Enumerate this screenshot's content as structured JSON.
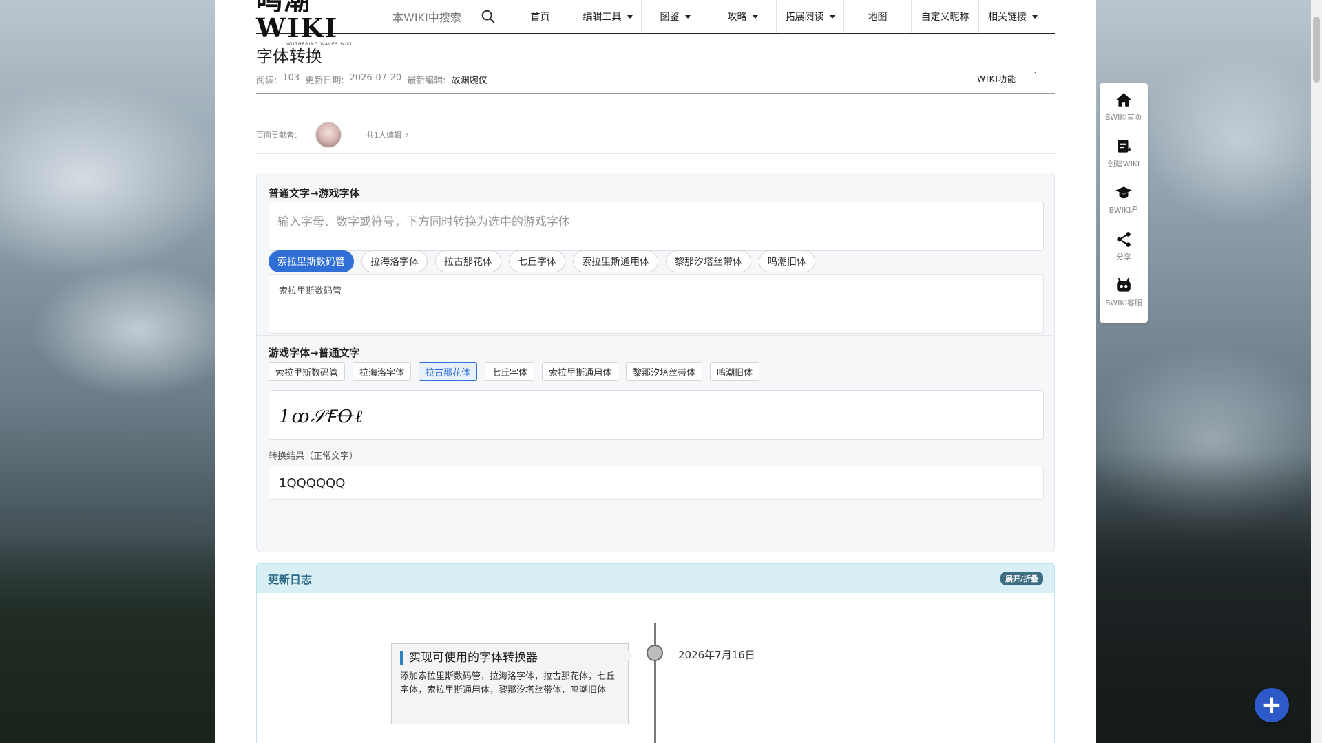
{
  "logo": {
    "main": "鸣潮WIKI",
    "sub": "WUTHERING WAVES WIKI"
  },
  "search": {
    "placeholder": "本WIKI中搜索"
  },
  "nav": [
    {
      "label": "首页",
      "dropdown": false
    },
    {
      "label": "编辑工具",
      "dropdown": true
    },
    {
      "label": "图鉴",
      "dropdown": true
    },
    {
      "label": "攻略",
      "dropdown": true
    },
    {
      "label": "拓展阅读",
      "dropdown": true
    },
    {
      "label": "地图",
      "dropdown": false
    },
    {
      "label": "自定义昵称",
      "dropdown": false
    },
    {
      "label": "相关链接",
      "dropdown": true
    }
  ],
  "page": {
    "title": "字体转换",
    "reads_label": "阅读:",
    "reads": "103",
    "updated_label": "更新日期:",
    "updated": "2026-07-20",
    "editor_label": "最新编辑:",
    "editor": "故渊婉仪",
    "wiki_func": "WIKI功能",
    "wiki_func_caret": "ˇ"
  },
  "contributors": {
    "label": "页面贡献者：",
    "count_text": "共1人编辑",
    "chevron": "›"
  },
  "converter": {
    "to_game_title": "普通文字→游戏字体",
    "input_placeholder": "输入字母、数字或符号，下方同时转换为选中的游戏字体",
    "fonts": [
      "索拉里斯数码管",
      "拉海洛字体",
      "拉古那花体",
      "七丘字体",
      "索拉里斯通用体",
      "黎那汐塔丝带体",
      "鸣潮旧体"
    ],
    "selected_font_top": "索拉里斯数码管",
    "output_text": "索拉里斯数码管",
    "to_text_title": "游戏字体→普通文字",
    "selected_font_bottom": "拉古那花体",
    "glyph_input": "1ꝏ𝒮ꞘꝊℓ",
    "result_label": "转换结果（正常文字）",
    "result_value": "1QQQQQQ"
  },
  "changelog": {
    "title": "更新日志",
    "toggle": "展开/折叠",
    "entries": [
      {
        "date": "2026年7月16日",
        "title": "实现可使用的字体转换器",
        "body": "添加索拉里斯数码管，拉海洛字体，拉古那花体，七丘字体，索拉里斯通用体，黎那汐塔丝带体，鸣潮旧体"
      }
    ]
  },
  "side_tools": [
    {
      "label": "BWIKI首页",
      "icon": "home-icon"
    },
    {
      "label": "创建WIKI",
      "icon": "create-doc-icon"
    },
    {
      "label": "BWIKI君",
      "icon": "graduation-cap-icon"
    },
    {
      "label": "分享",
      "icon": "share-icon"
    },
    {
      "label": "BWIKI客服",
      "icon": "robot-icon"
    }
  ],
  "fab": {
    "label": "+"
  },
  "colors": {
    "accent": "#2f6fd6",
    "fab": "#2d59c9",
    "changelog_head": "#d8eff6"
  }
}
